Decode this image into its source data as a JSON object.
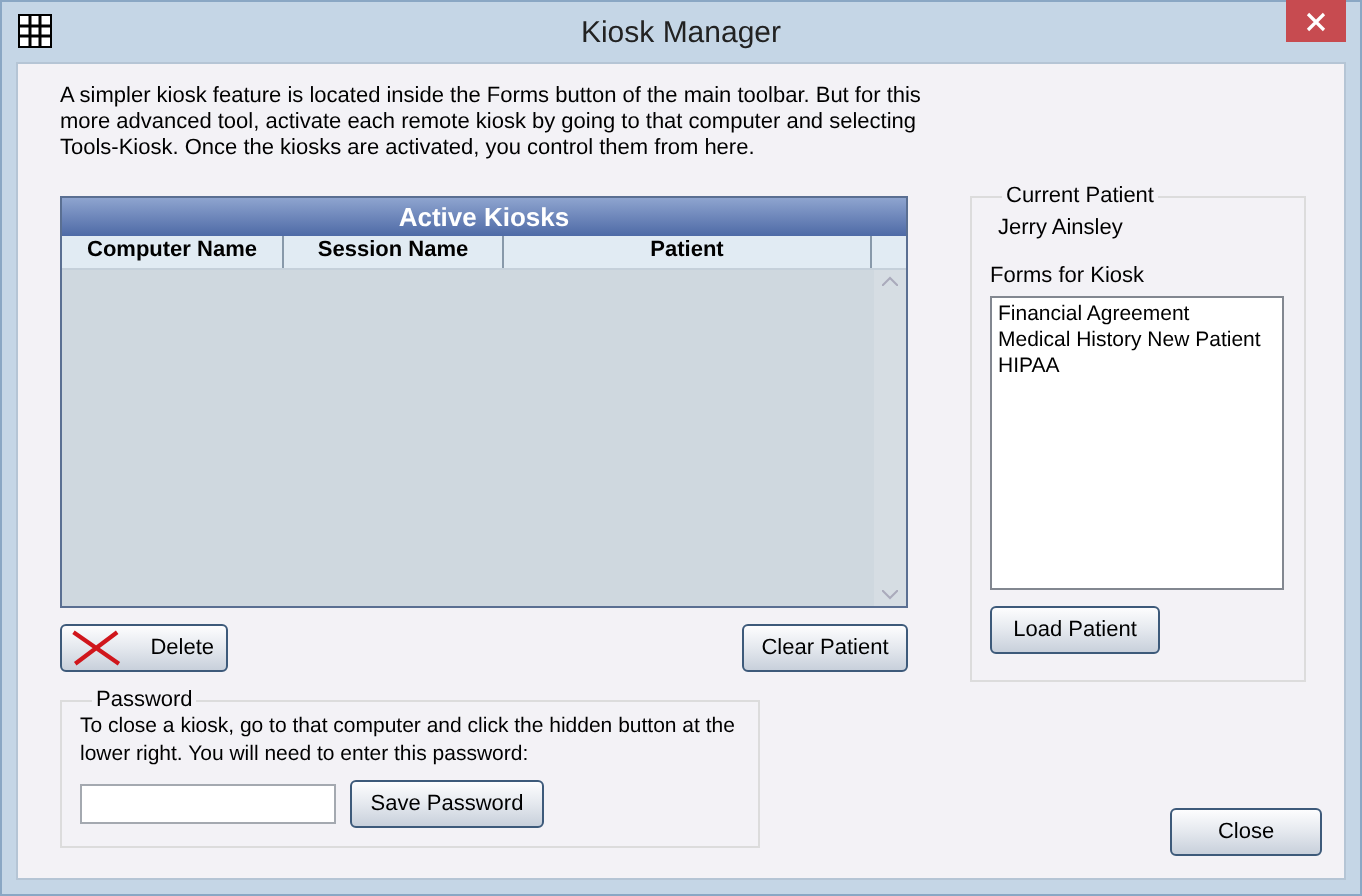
{
  "window": {
    "title": "Kiosk Manager"
  },
  "intro": "A simpler kiosk feature is located inside the Forms button of the main toolbar.  But for this more advanced tool, activate each remote kiosk by going to that computer and selecting Tools-Kiosk.  Once the kiosks are activated, you control them from here.",
  "kiosk_grid": {
    "title": "Active Kiosks",
    "columns": [
      "Computer Name",
      "Session Name",
      "Patient"
    ]
  },
  "grid_buttons": {
    "delete": "Delete",
    "clear": "Clear Patient"
  },
  "current_patient": {
    "legend": "Current Patient",
    "name": "Jerry Ainsley",
    "forms_label": "Forms for Kiosk",
    "forms": [
      {
        "label": "Financial Agreement"
      },
      {
        "label": "Medical History New Patient"
      },
      {
        "label": "HIPAA"
      }
    ],
    "load_button": "Load Patient"
  },
  "password": {
    "legend": "Password",
    "instructions": "To close a kiosk, go to that computer and click the hidden button at the lower right.  You will need to enter this password:",
    "save_button": "Save Password"
  },
  "close_button": "Close"
}
